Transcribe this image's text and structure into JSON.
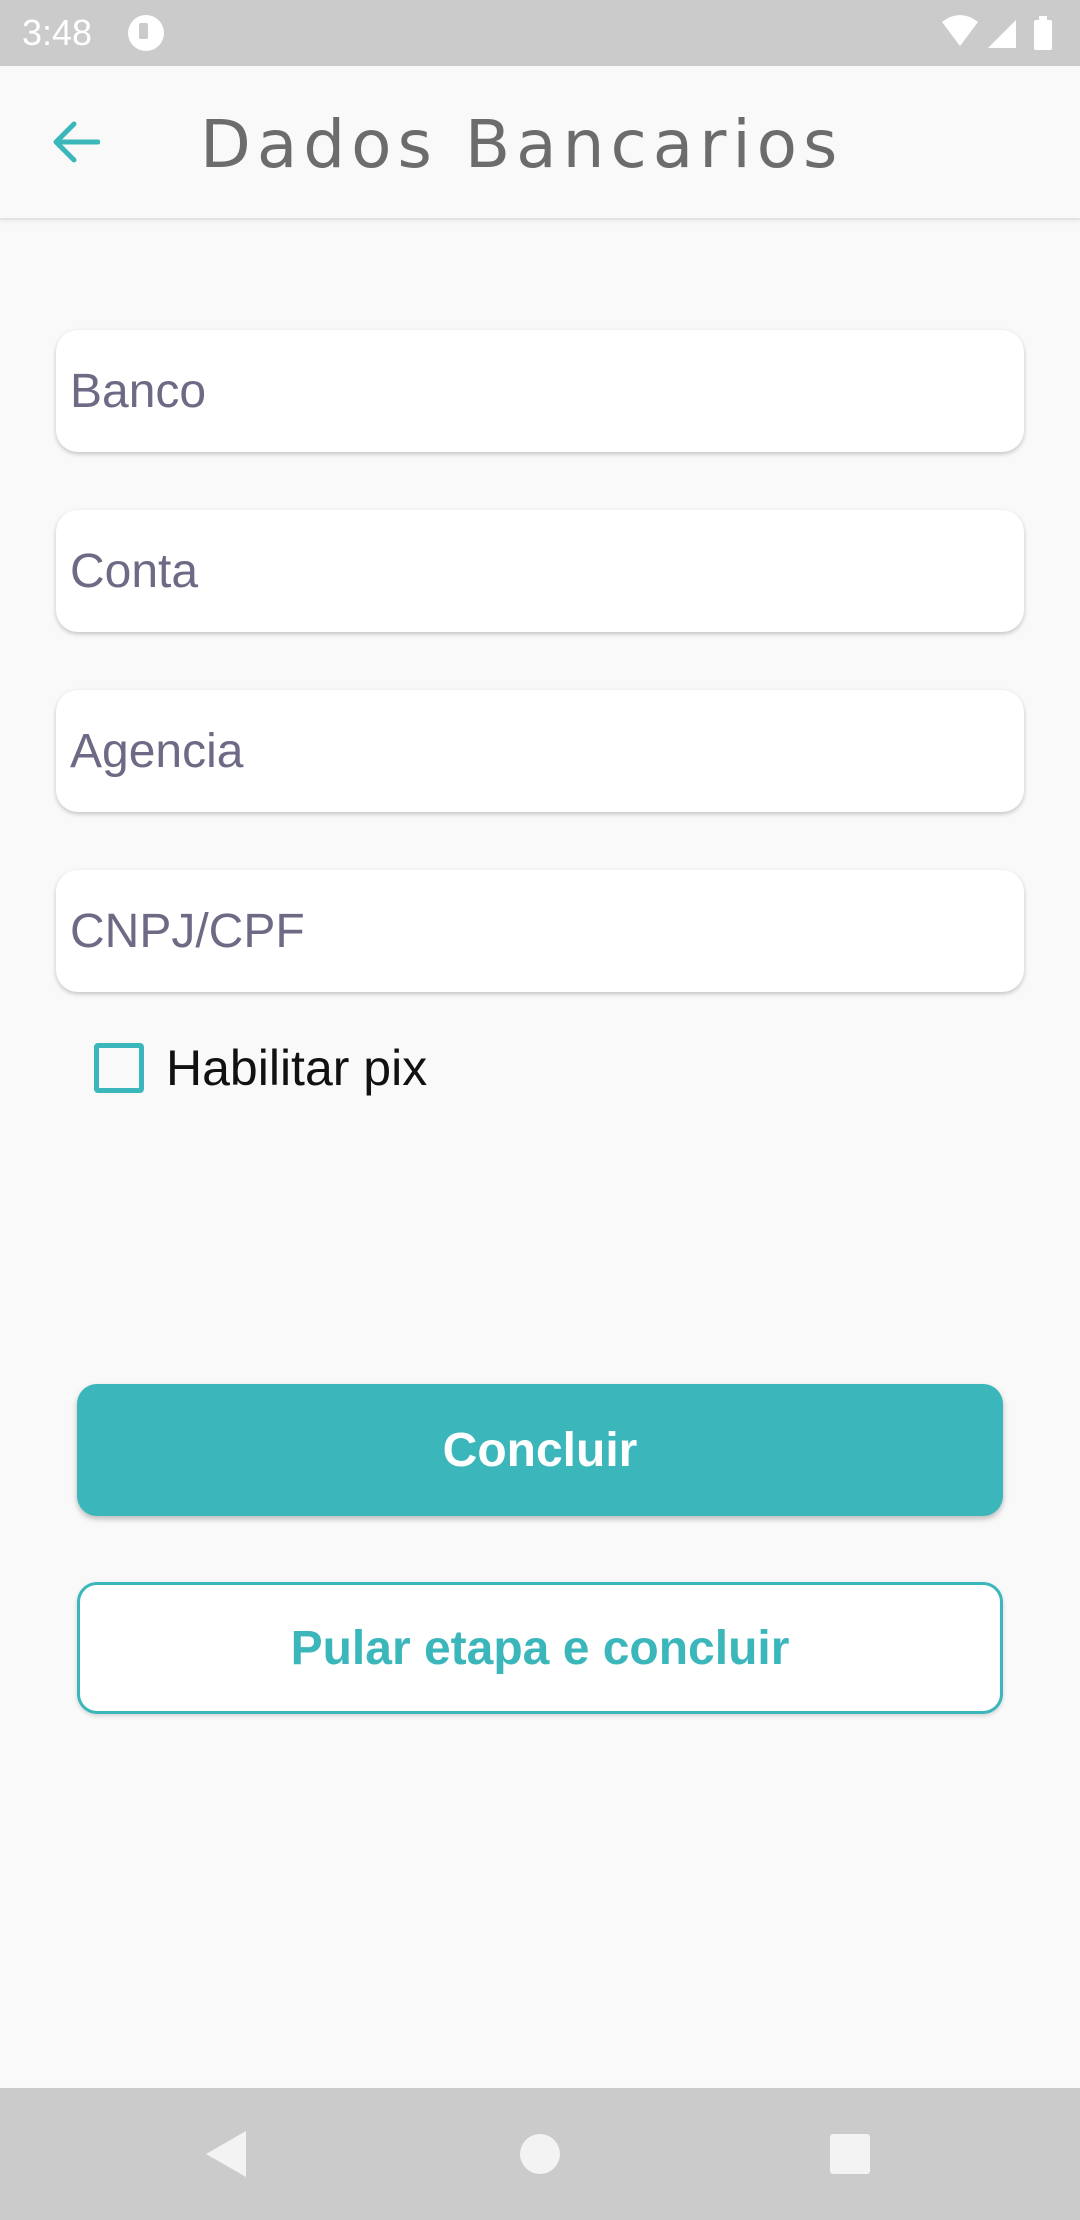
{
  "status_bar": {
    "time": "3:48"
  },
  "app_bar": {
    "title": "Dados Bancarios",
    "back_icon": "arrow-left-icon"
  },
  "form": {
    "bank_placeholder": "Banco",
    "account_placeholder": "Conta",
    "agency_placeholder": "Agencia",
    "document_placeholder": "CNPJ/CPF",
    "pix_label": "Habilitar pix",
    "pix_checked": false
  },
  "actions": {
    "finish_label": "Concluir",
    "skip_label": "Pular etapa e concluir"
  },
  "colors": {
    "accent": "#3bb7bc",
    "title": "#6c6c6c",
    "placeholder": "#6d6a85",
    "system_bar": "#cbcbcb"
  }
}
